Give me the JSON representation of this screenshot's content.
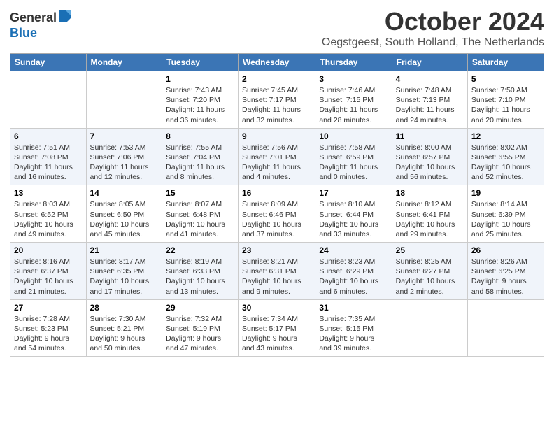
{
  "logo": {
    "general": "General",
    "blue": "Blue"
  },
  "title": "October 2024",
  "subtitle": "Oegstgeest, South Holland, The Netherlands",
  "weekdays": [
    "Sunday",
    "Monday",
    "Tuesday",
    "Wednesday",
    "Thursday",
    "Friday",
    "Saturday"
  ],
  "weeks": [
    [
      {
        "day": "",
        "detail": ""
      },
      {
        "day": "",
        "detail": ""
      },
      {
        "day": "1",
        "detail": "Sunrise: 7:43 AM\nSunset: 7:20 PM\nDaylight: 11 hours\nand 36 minutes."
      },
      {
        "day": "2",
        "detail": "Sunrise: 7:45 AM\nSunset: 7:17 PM\nDaylight: 11 hours\nand 32 minutes."
      },
      {
        "day": "3",
        "detail": "Sunrise: 7:46 AM\nSunset: 7:15 PM\nDaylight: 11 hours\nand 28 minutes."
      },
      {
        "day": "4",
        "detail": "Sunrise: 7:48 AM\nSunset: 7:13 PM\nDaylight: 11 hours\nand 24 minutes."
      },
      {
        "day": "5",
        "detail": "Sunrise: 7:50 AM\nSunset: 7:10 PM\nDaylight: 11 hours\nand 20 minutes."
      }
    ],
    [
      {
        "day": "6",
        "detail": "Sunrise: 7:51 AM\nSunset: 7:08 PM\nDaylight: 11 hours\nand 16 minutes."
      },
      {
        "day": "7",
        "detail": "Sunrise: 7:53 AM\nSunset: 7:06 PM\nDaylight: 11 hours\nand 12 minutes."
      },
      {
        "day": "8",
        "detail": "Sunrise: 7:55 AM\nSunset: 7:04 PM\nDaylight: 11 hours\nand 8 minutes."
      },
      {
        "day": "9",
        "detail": "Sunrise: 7:56 AM\nSunset: 7:01 PM\nDaylight: 11 hours\nand 4 minutes."
      },
      {
        "day": "10",
        "detail": "Sunrise: 7:58 AM\nSunset: 6:59 PM\nDaylight: 11 hours\nand 0 minutes."
      },
      {
        "day": "11",
        "detail": "Sunrise: 8:00 AM\nSunset: 6:57 PM\nDaylight: 10 hours\nand 56 minutes."
      },
      {
        "day": "12",
        "detail": "Sunrise: 8:02 AM\nSunset: 6:55 PM\nDaylight: 10 hours\nand 52 minutes."
      }
    ],
    [
      {
        "day": "13",
        "detail": "Sunrise: 8:03 AM\nSunset: 6:52 PM\nDaylight: 10 hours\nand 49 minutes."
      },
      {
        "day": "14",
        "detail": "Sunrise: 8:05 AM\nSunset: 6:50 PM\nDaylight: 10 hours\nand 45 minutes."
      },
      {
        "day": "15",
        "detail": "Sunrise: 8:07 AM\nSunset: 6:48 PM\nDaylight: 10 hours\nand 41 minutes."
      },
      {
        "day": "16",
        "detail": "Sunrise: 8:09 AM\nSunset: 6:46 PM\nDaylight: 10 hours\nand 37 minutes."
      },
      {
        "day": "17",
        "detail": "Sunrise: 8:10 AM\nSunset: 6:44 PM\nDaylight: 10 hours\nand 33 minutes."
      },
      {
        "day": "18",
        "detail": "Sunrise: 8:12 AM\nSunset: 6:41 PM\nDaylight: 10 hours\nand 29 minutes."
      },
      {
        "day": "19",
        "detail": "Sunrise: 8:14 AM\nSunset: 6:39 PM\nDaylight: 10 hours\nand 25 minutes."
      }
    ],
    [
      {
        "day": "20",
        "detail": "Sunrise: 8:16 AM\nSunset: 6:37 PM\nDaylight: 10 hours\nand 21 minutes."
      },
      {
        "day": "21",
        "detail": "Sunrise: 8:17 AM\nSunset: 6:35 PM\nDaylight: 10 hours\nand 17 minutes."
      },
      {
        "day": "22",
        "detail": "Sunrise: 8:19 AM\nSunset: 6:33 PM\nDaylight: 10 hours\nand 13 minutes."
      },
      {
        "day": "23",
        "detail": "Sunrise: 8:21 AM\nSunset: 6:31 PM\nDaylight: 10 hours\nand 9 minutes."
      },
      {
        "day": "24",
        "detail": "Sunrise: 8:23 AM\nSunset: 6:29 PM\nDaylight: 10 hours\nand 6 minutes."
      },
      {
        "day": "25",
        "detail": "Sunrise: 8:25 AM\nSunset: 6:27 PM\nDaylight: 10 hours\nand 2 minutes."
      },
      {
        "day": "26",
        "detail": "Sunrise: 8:26 AM\nSunset: 6:25 PM\nDaylight: 9 hours\nand 58 minutes."
      }
    ],
    [
      {
        "day": "27",
        "detail": "Sunrise: 7:28 AM\nSunset: 5:23 PM\nDaylight: 9 hours\nand 54 minutes."
      },
      {
        "day": "28",
        "detail": "Sunrise: 7:30 AM\nSunset: 5:21 PM\nDaylight: 9 hours\nand 50 minutes."
      },
      {
        "day": "29",
        "detail": "Sunrise: 7:32 AM\nSunset: 5:19 PM\nDaylight: 9 hours\nand 47 minutes."
      },
      {
        "day": "30",
        "detail": "Sunrise: 7:34 AM\nSunset: 5:17 PM\nDaylight: 9 hours\nand 43 minutes."
      },
      {
        "day": "31",
        "detail": "Sunrise: 7:35 AM\nSunset: 5:15 PM\nDaylight: 9 hours\nand 39 minutes."
      },
      {
        "day": "",
        "detail": ""
      },
      {
        "day": "",
        "detail": ""
      }
    ]
  ]
}
